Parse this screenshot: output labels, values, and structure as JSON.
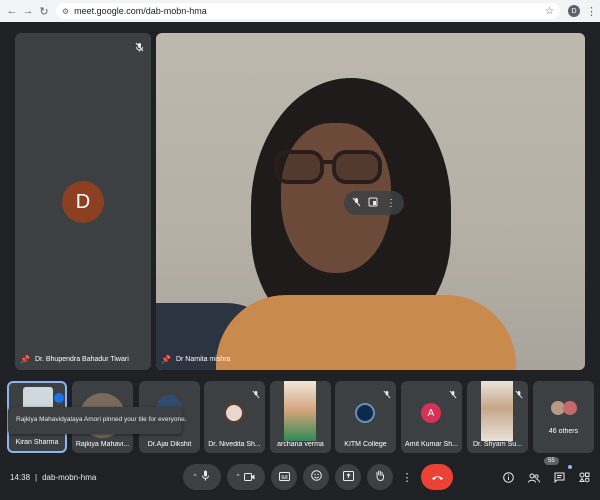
{
  "browser": {
    "url": "meet.google.com/dab-mobn-hma",
    "profile_letter": "D"
  },
  "main": {
    "left_tile": {
      "avatar_letter": "D",
      "name": "Dr. Bhupendra Bahadur Tiwari"
    },
    "featured_tile": {
      "name": "Dr Namita mishra"
    }
  },
  "filmstrip": [
    {
      "name": "Kiran Sharma"
    },
    {
      "name": "Rajkiya Mahavi..."
    },
    {
      "name": "Dr.Ajai Dikshit"
    },
    {
      "name": "Dr. Nivedita Sh..."
    },
    {
      "name": "archana verma"
    },
    {
      "name": "KITM College"
    },
    {
      "name": "Amit Kumar Sh...",
      "avatar_letter": "A"
    },
    {
      "name": "Dr. Shyam Su..."
    },
    {
      "name": "46 others"
    }
  ],
  "toast": {
    "message": "Rajkiya Mahavidyalaya Amori pinned your tile for everyone."
  },
  "bottom_bar": {
    "time": "14:38",
    "separator": "|",
    "meeting_code": "dab-mobn-hma",
    "participants_count": "55"
  },
  "colors": {
    "background": "#202124",
    "tile": "#3c4043",
    "end_call": "#ea4335",
    "accent": "#8ab4f8"
  }
}
